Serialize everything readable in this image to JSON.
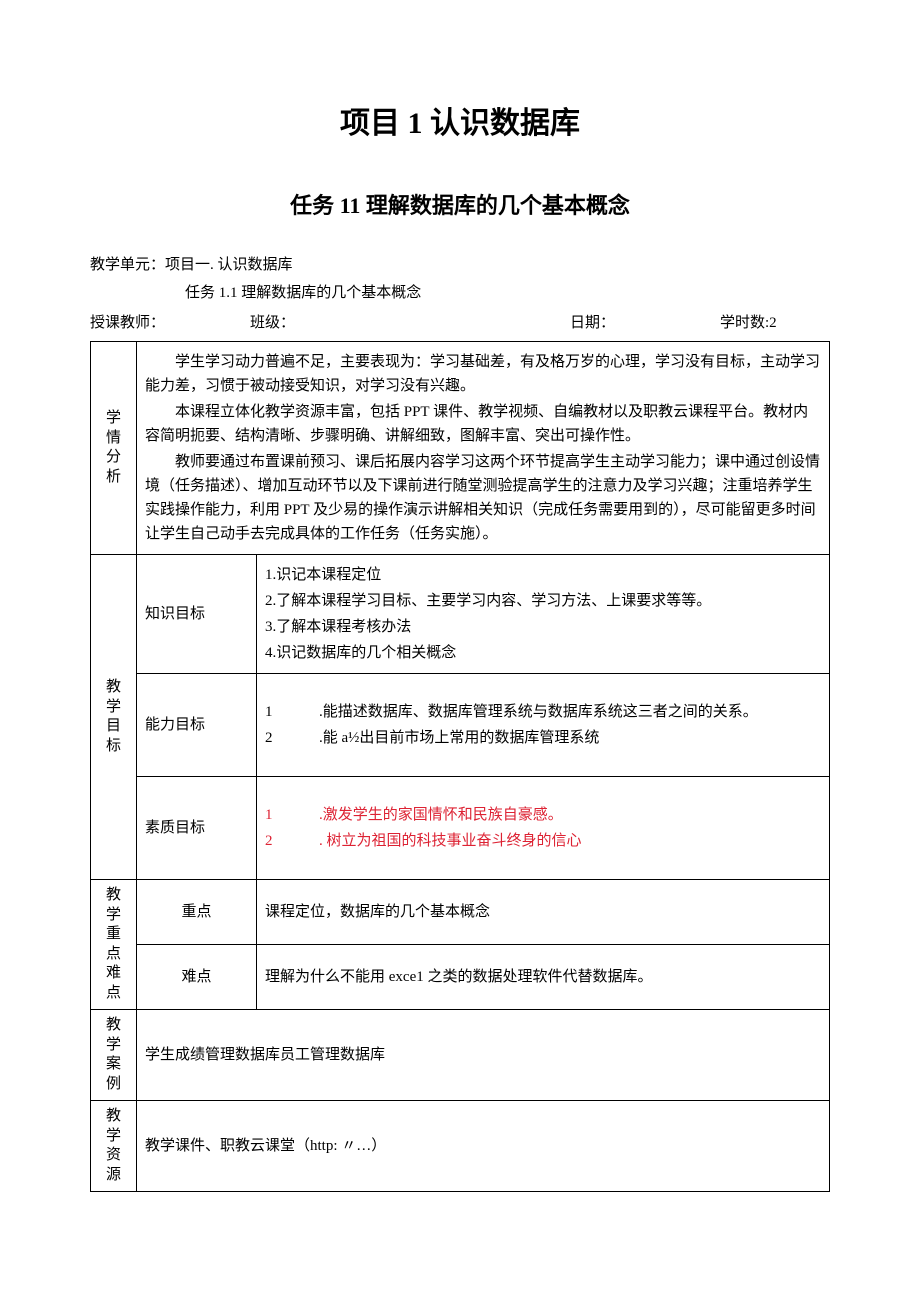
{
  "title": "项目 1 认识数据库",
  "subtitle": "任务 11 理解数据库的几个基本概念",
  "meta": {
    "unit_label": "教学单元：",
    "unit_value": "项目一. 认识数据库",
    "task_line": "任务 1.1 理解数据库的几个基本概念",
    "teacher_label": "授课教师：",
    "class_label": "班级：",
    "date_label": "日期：",
    "hours_label": "学时数:",
    "hours_value": "2"
  },
  "analysis": {
    "label": "学情分析",
    "p1": "学生学习动力普遍不足，主要表现为：学习基础差，有及格万岁的心理，学习没有目标，主动学习能力差，习惯于被动接受知识，对学习没有兴趣。",
    "p2": "本课程立体化教学资源丰富，包括 PPT 课件、教学视频、自编教材以及职教云课程平台。教材内容简明扼要、结构清晰、步骤明确、讲解细致，图解丰富、突出可操作性。",
    "p3": "教师要通过布置课前预习、课后拓展内容学习这两个环节提高学生主动学习能力；课中通过创设情境（任务描述）、增加互动环节以及下课前进行随堂测验提高学生的注意力及学习兴趣；注重培养学生实践操作能力，利用 PPT 及少易的操作演示讲解相关知识（完成任务需要用到的），尽可能留更多时间让学生自己动手去完成具体的工作任务（任务实施）。"
  },
  "goals": {
    "label": "教学目标",
    "knowledge": {
      "label": "知识目标",
      "items": [
        "1.识记本课程定位",
        "2.了解本课程学习目标、主要学习内容、学习方法、上课要求等等。",
        "3.了解本课程考核办法",
        "4.识记数据库的几个相关概念"
      ]
    },
    "ability": {
      "label": "能力目标",
      "items": [
        {
          "num": "1",
          "text": ".能描述数据库、数据库管理系统与数据库系统这三者之间的关系。"
        },
        {
          "num": "2",
          "text": ".能 a½出目前市场上常用的数据库管理系统"
        }
      ]
    },
    "quality": {
      "label": "素质目标",
      "items": [
        {
          "num": "1",
          "text": ".激发学生的家国情怀和民族自豪感。"
        },
        {
          "num": "2",
          "text": ". 树立为祖国的科技事业奋斗终身的信心"
        }
      ]
    }
  },
  "keypoints": {
    "label": "教学重点难点",
    "key_label": "重点",
    "key_text": "课程定位，数据库的几个基本概念",
    "diff_label": "难点",
    "diff_text": "理解为什么不能用 exce1 之类的数据处理软件代替数据库。"
  },
  "case": {
    "label": "教学案例",
    "text": "学生成绩管理数据库员工管理数据库"
  },
  "resource": {
    "label": "教学资源",
    "text": "教学课件、职教云课堂（http: 〃…）"
  }
}
